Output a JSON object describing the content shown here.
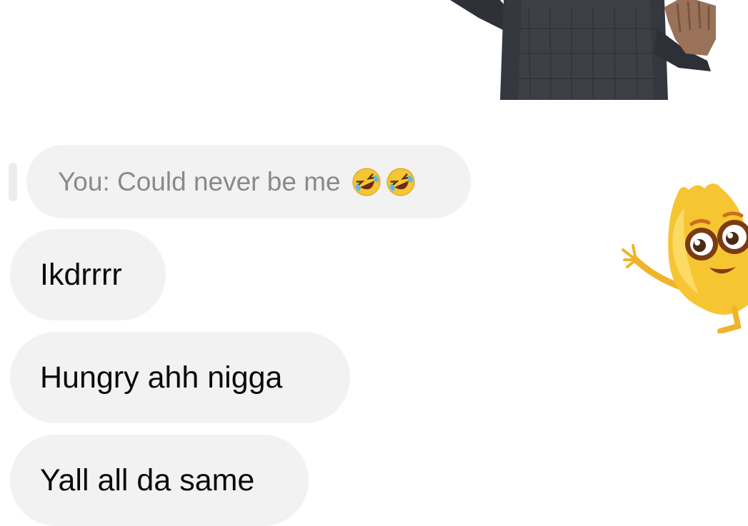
{
  "stickers": {
    "top": "person-waving-sticker",
    "right": "yellow-mascot-waving-sticker"
  },
  "reply": {
    "text": "You: Could never be me",
    "emoji": [
      "rolling-on-floor-laughing-emoji",
      "rolling-on-floor-laughing-emoji"
    ]
  },
  "messages": [
    {
      "text": "Ikdrrrr"
    },
    {
      "text": "Hungry ahh nigga"
    },
    {
      "text": "Yall all da same"
    }
  ],
  "colors": {
    "bubble": "#f2f2f2",
    "reply_text": "#8a8a8a",
    "message_text": "#0a0a0a"
  }
}
